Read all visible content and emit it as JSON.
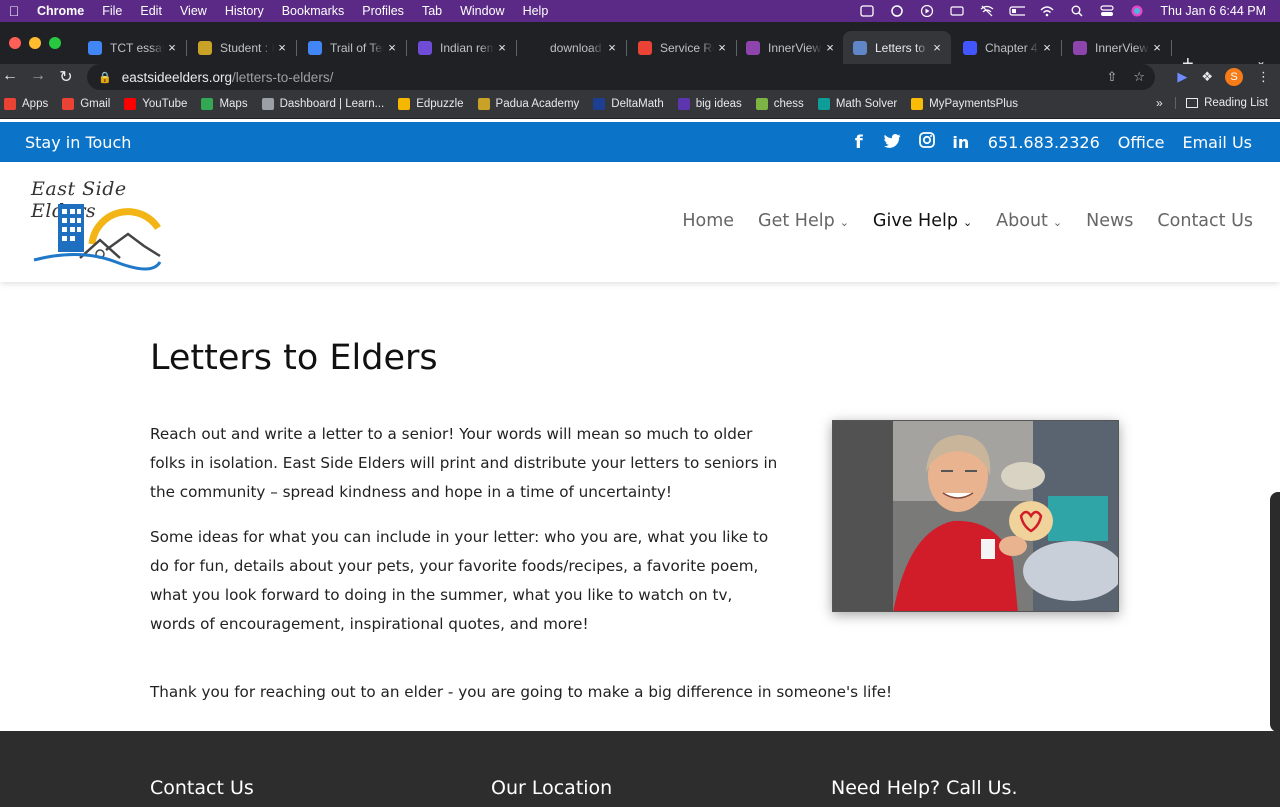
{
  "menubar": {
    "app": "Chrome",
    "items": [
      "File",
      "Edit",
      "View",
      "History",
      "Bookmarks",
      "Profiles",
      "Tab",
      "Window",
      "Help"
    ],
    "clock": "Thu Jan 6  6:44 PM",
    "status_icons": [
      "screen-mirror-icon",
      "creative-cloud-icon",
      "play-icon",
      "keyboard-icon",
      "wifi-off-icon",
      "battery-icon",
      "wifi-icon",
      "spotlight-icon",
      "control-center-icon",
      "siri-icon"
    ]
  },
  "tabs": [
    {
      "title": "TCT essay",
      "icon": "google-docs-icon",
      "color": "#4285f4"
    },
    {
      "title": "Student : I",
      "icon": "school-icon",
      "color": "#c9a227"
    },
    {
      "title": "Trail of Tea",
      "icon": "google-docs-icon",
      "color": "#4285f4"
    },
    {
      "title": "Indian rem",
      "icon": "meet-icon",
      "color": "#6f4bd8"
    },
    {
      "title": "download",
      "icon": "blank-icon",
      "color": "#202124"
    },
    {
      "title": "Service Re",
      "icon": "gmail-icon",
      "color": "#ea4335"
    },
    {
      "title": "InnerView",
      "icon": "innerview-icon",
      "color": "#8e44ad"
    },
    {
      "title": "Letters to",
      "icon": "page-icon",
      "color": "#5f87c7",
      "active": true
    },
    {
      "title": "Chapter 4",
      "icon": "quizlet-icon",
      "color": "#4255ff"
    },
    {
      "title": "InnerView",
      "icon": "innerview-icon",
      "color": "#8e44ad"
    }
  ],
  "address": {
    "host": "eastsideelders.org",
    "path": "/letters-to-elders/"
  },
  "bookmarks": [
    {
      "label": "Apps",
      "icon": "apps-grid-icon",
      "color": "#ea4335"
    },
    {
      "label": "Gmail",
      "icon": "gmail-icon",
      "color": "#ea4335"
    },
    {
      "label": "YouTube",
      "icon": "youtube-icon",
      "color": "#ff0000"
    },
    {
      "label": "Maps",
      "icon": "maps-icon",
      "color": "#34a853"
    },
    {
      "label": "Dashboard | Learn...",
      "icon": "dashboard-icon",
      "color": "#9aa0a6"
    },
    {
      "label": "Edpuzzle",
      "icon": "edpuzzle-icon",
      "color": "#f5b700"
    },
    {
      "label": "Padua Academy",
      "icon": "school-icon",
      "color": "#c9a227"
    },
    {
      "label": "DeltaMath",
      "icon": "deltamath-icon",
      "color": "#1c3f94"
    },
    {
      "label": "big ideas",
      "icon": "bigideas-icon",
      "color": "#5e35b1"
    },
    {
      "label": "chess",
      "icon": "chess-icon",
      "color": "#7cb342"
    },
    {
      "label": "Math Solver",
      "icon": "math-solver-icon",
      "color": "#0f9d9a"
    },
    {
      "label": "MyPaymentsPlus",
      "icon": "payments-icon",
      "color": "#fbbc05"
    }
  ],
  "reading_list": "Reading List",
  "site": {
    "topbar": {
      "left": "Stay in Touch",
      "phone": "651.683.2326",
      "office": "Office",
      "email": "Email Us",
      "social_icons": [
        "facebook-icon",
        "twitter-icon",
        "instagram-icon",
        "linkedin-icon"
      ]
    },
    "logo_text": "East Side Elders",
    "nav": [
      {
        "label": "Home",
        "dropdown": false
      },
      {
        "label": "Get Help",
        "dropdown": true
      },
      {
        "label": "Give Help",
        "dropdown": true,
        "active": true
      },
      {
        "label": "About",
        "dropdown": true
      },
      {
        "label": "News",
        "dropdown": false
      },
      {
        "label": "Contact Us",
        "dropdown": false
      }
    ],
    "heading": "Letters to Elders",
    "paragraphs": [
      "Reach out and write a letter to a senior!  Your words will mean so much to older folks in isolation.  East Side Elders will print and distribute your letters to seniors in the community – spread kindness and hope in a time of uncertainty!",
      "Some ideas for what you can include in your letter:  who you are, what you like to do for fun, details about your pets, your favorite foods/recipes, a favorite poem, what you look forward to doing in the summer, what you like to watch on tv, words of encouragement, inspirational quotes, and more!",
      "Thank you for reaching out to an elder - you are going to make a big difference in someone's life!"
    ],
    "footer": [
      "Contact Us",
      "Our Location",
      "Need Help?  Call Us."
    ]
  },
  "colors": {
    "menubar": "#5b2a86",
    "site_blue": "#0b74c9",
    "footer": "#2d2d2d"
  }
}
